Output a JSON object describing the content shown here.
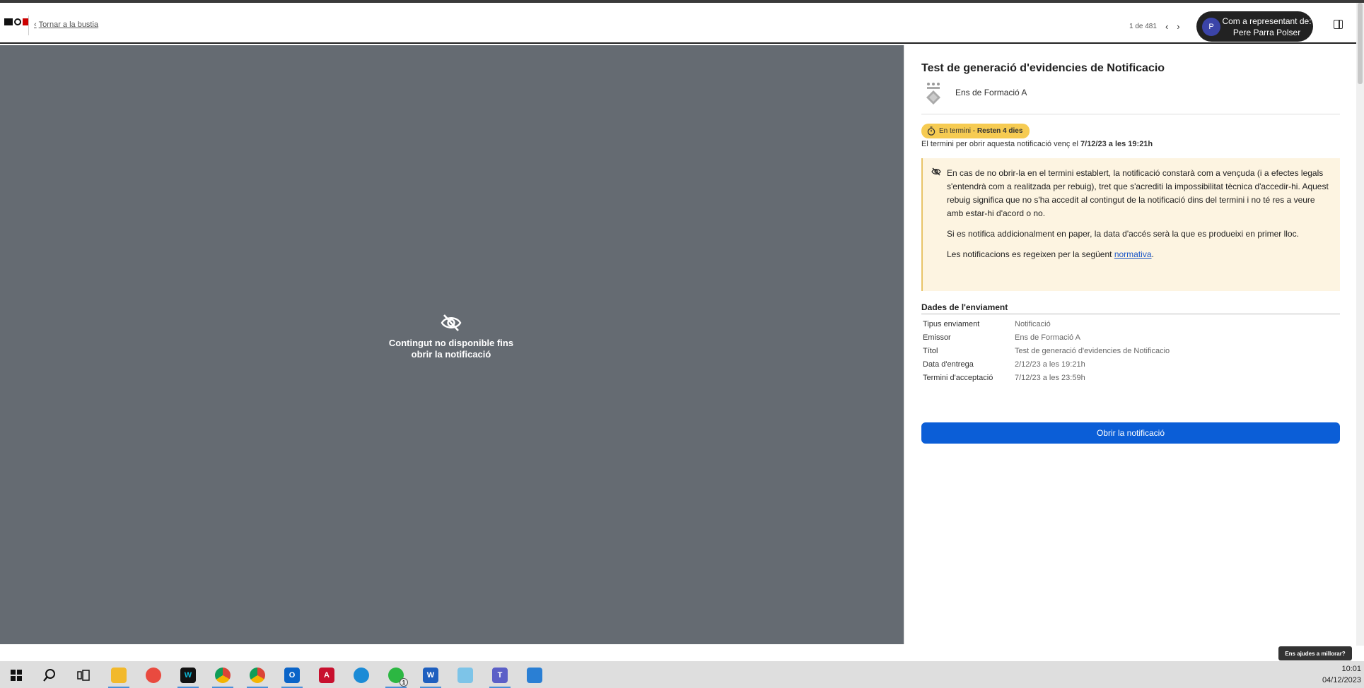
{
  "header": {
    "logo_alt": "AOC",
    "back_label": "Tornar a la bustia",
    "pager_text": "1 de 481",
    "representative": {
      "avatar_initial": "P",
      "line1": "Com a representant de:",
      "line2": "Pere Parra Polser"
    }
  },
  "viewer": {
    "unavailable_line1": "Contingut no disponible fins",
    "unavailable_line2": "obrir la notificació"
  },
  "detail": {
    "title": "Test de generació d'evidencies de Notificacio",
    "entity_name": "Ens de Formació A",
    "badge_status": "En termini",
    "badge_sep": " - ",
    "badge_remaining": "Resten 4 dies",
    "deadline_prefix": "El termini per obrir aquesta notificació venç el",
    "deadline_date": "7/12/23 a les 19:21h",
    "warning": {
      "p1": "En cas de no obrir-la en el termini establert, la notificació constarà com a vençuda (i a efectes legals s'entendrà com a realitzada per rebuig), tret que s'acrediti la impossibilitat tècnica d'accedir-hi. Aquest rebuig significa que no s'ha accedit al contingut de la notificació dins del termini i no té res a veure amb estar-hi d'acord o no.",
      "p2": "Si es notifica addicionalment en paper, la data d'accés serà la que es produeixi en primer lloc.",
      "p3_prefix": "Les notificacions es regeixen per la següent",
      "p3_link": "normativa",
      "p3_suffix": "."
    },
    "section_title": "Dades de l'enviament",
    "fields": [
      {
        "key": "Tipus enviament",
        "value": "Notificació"
      },
      {
        "key": "Emissor",
        "value": "Ens de Formació A"
      },
      {
        "key": "Títol",
        "value": "Test de generació d'evidencies de Notificacio"
      },
      {
        "key": "Data d'entrega",
        "value": "2/12/23 a les 19:21h"
      },
      {
        "key": "Termini d'acceptació",
        "value": "7/12/23 a les 23:59h"
      }
    ],
    "open_button": "Obrir la notificació"
  },
  "feedback_label": "Ens ajudes a millorar?",
  "taskbar": {
    "time": "10:01",
    "date": "04/12/2023",
    "whatsapp_badge": "1",
    "icons": [
      "windows-start",
      "search",
      "task-view",
      "file-explorer",
      "app-red",
      "webex",
      "chrome",
      "chrome-profile",
      "outlook",
      "acrobat",
      "edge",
      "whatsapp",
      "word",
      "paint",
      "teams",
      "photos"
    ]
  }
}
